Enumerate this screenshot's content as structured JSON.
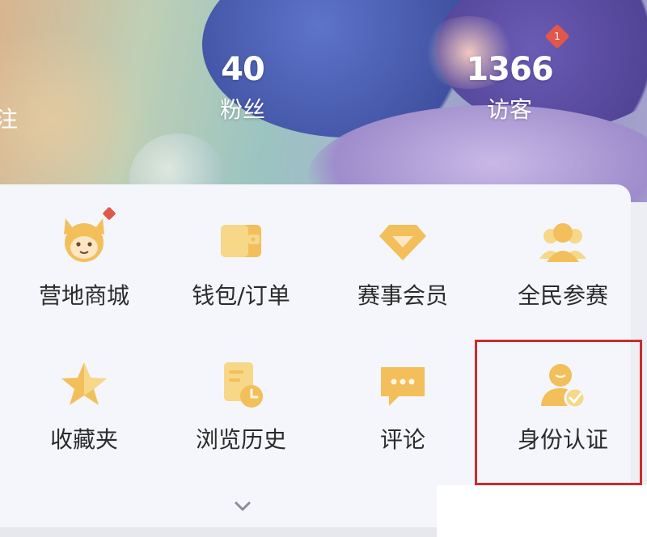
{
  "stats": {
    "partial_label": "注",
    "fans": {
      "value": "40",
      "label": "粉丝"
    },
    "visitors": {
      "value": "1366",
      "label": "访客",
      "badge": "1"
    }
  },
  "menu": {
    "row1": [
      {
        "label": "营地商城",
        "icon": "camp-mascot-icon",
        "has_dot": true
      },
      {
        "label": "钱包/订单",
        "icon": "wallet-icon"
      },
      {
        "label": "赛事会员",
        "icon": "diamond-icon"
      },
      {
        "label": "全民参赛",
        "icon": "group-icon"
      }
    ],
    "row2": [
      {
        "label": "收藏夹",
        "icon": "star-icon"
      },
      {
        "label": "浏览历史",
        "icon": "history-icon"
      },
      {
        "label": "评论",
        "icon": "comment-icon"
      },
      {
        "label": "身份认证",
        "icon": "identity-verify-icon"
      }
    ],
    "expand": "chevron-down-icon"
  },
  "colors": {
    "icon_accent": "#f2bf5b",
    "icon_light": "#f7d788",
    "badge_red": "#e0574b",
    "highlight_red": "#c92b2b"
  }
}
